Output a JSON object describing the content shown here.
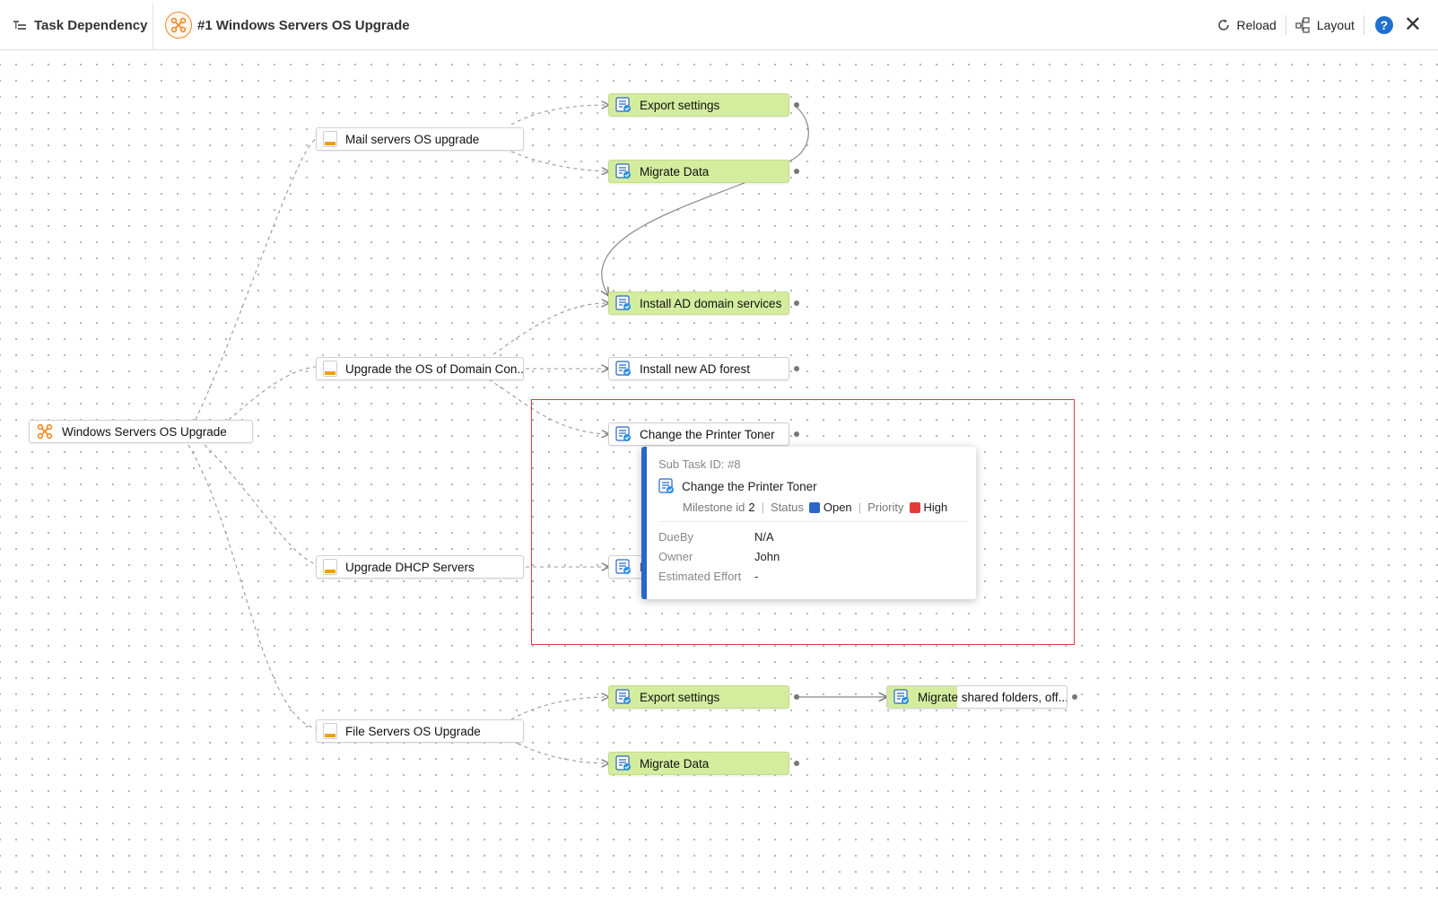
{
  "header": {
    "title": "Task Dependency",
    "project_title": "#1 Windows Servers OS Upgrade",
    "reload_label": "Reload",
    "layout_label": "Layout",
    "help_label": "?",
    "close_label": "✕"
  },
  "nodes": {
    "root": "Windows Servers OS Upgrade",
    "mail": "Mail servers OS upgrade",
    "domain": "Upgrade the OS of Domain Con...",
    "dhcp": "Upgrade DHCP Servers",
    "file": "File Servers OS Upgrade",
    "export1": "Export settings",
    "migrate1": "Migrate Data",
    "install_ad": "Install AD domain services",
    "install_forest": "Install new AD forest",
    "printer": "Change the Printer Toner",
    "dhcp_task": "I",
    "export2": "Export settings",
    "migrate_shared": "Migrate shared folders, off...",
    "migrate2": "Migrate Data"
  },
  "tooltip": {
    "sub_task_id": "Sub Task ID: #8",
    "name": "Change the Printer Toner",
    "milestone_label": "Milestone id",
    "milestone_value": "2",
    "status_label": "Status",
    "status_value": "Open",
    "priority_label": "Priority",
    "priority_value": "High",
    "dueby_label": "DueBy",
    "dueby_value": "N/A",
    "owner_label": "Owner",
    "owner_value": "John",
    "effort_label": "Estimated Effort",
    "effort_value": "-"
  },
  "colors": {
    "accent": "#f08a24",
    "task_green": "#d4ec9e",
    "status_open": "#2a65c9",
    "priority_high": "#e43a3a",
    "selection_border": "#e43a3a"
  }
}
